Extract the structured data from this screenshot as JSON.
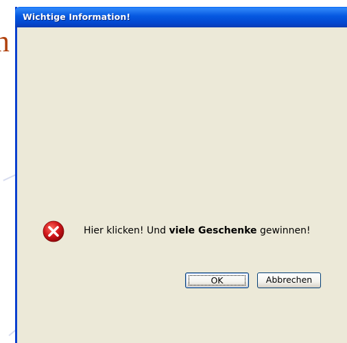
{
  "dialog": {
    "title": "Wichtige Information!",
    "close_icon": "close-x-icon",
    "icon": "error-icon",
    "message_before": "Hier klicken! Und ",
    "message_bold": "viele Geschenke",
    "message_after": " gewinnen!",
    "ok_label": "OK",
    "cancel_label": "Abbrechen"
  },
  "background": {
    "glyph": "n"
  },
  "colors": {
    "titlebar": "#0558e0",
    "body": "#ece9d8",
    "close": "#e05a2c",
    "error": "#d0161a"
  }
}
